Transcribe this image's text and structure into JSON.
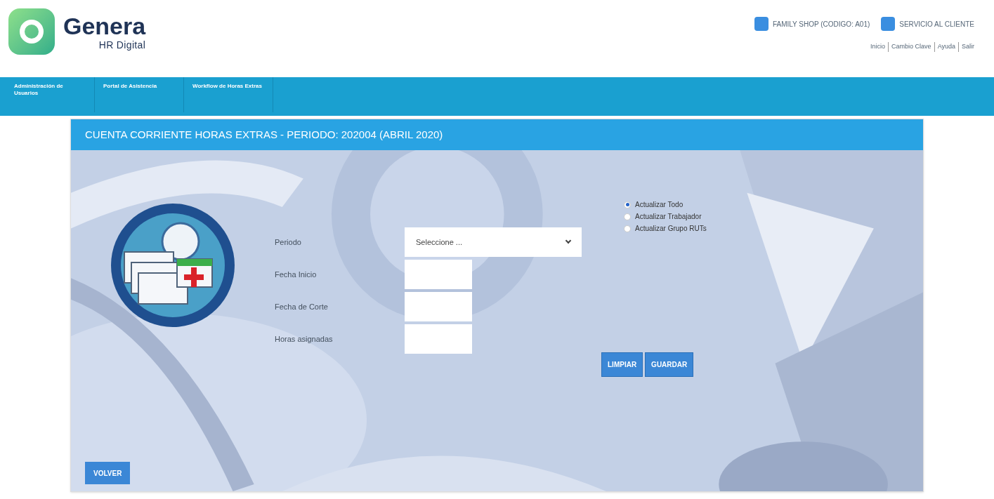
{
  "logo": {
    "name": "Genera",
    "tagline": "HR Digital"
  },
  "header_links": [
    {
      "label": "FAMILY SHOP (CODIGO: A01)"
    },
    {
      "label": "SERVICIO AL CLIENTE"
    }
  ],
  "user_links": [
    "Inicio",
    "Cambio Clave",
    "Ayuda",
    "Salir"
  ],
  "nav": [
    {
      "label": "Administración de Usuarios"
    },
    {
      "label": "Portal de Asistencia"
    },
    {
      "label": "Workflow de Horas Extras"
    }
  ],
  "panel": {
    "title": "CUENTA CORRIENTE HORAS EXTRAS - PERIODO: 202004 (ABRIL 2020)",
    "fields": [
      {
        "kind": "select",
        "label": "Periodo",
        "value": "Seleccione ..."
      },
      {
        "kind": "text",
        "label": "Fecha Inicio"
      },
      {
        "kind": "text",
        "label": "Fecha de Corte"
      },
      {
        "kind": "text",
        "label": "Horas asignadas"
      }
    ],
    "options": [
      {
        "label": "Actualizar Todo",
        "selected": true
      },
      {
        "label": "Actualizar Trabajador",
        "selected": false
      },
      {
        "label": "Actualizar Grupo RUTs",
        "selected": false
      }
    ],
    "buttons": [
      "LIMPIAR",
      "GUARDAR"
    ],
    "back_button": "VOLVER"
  }
}
